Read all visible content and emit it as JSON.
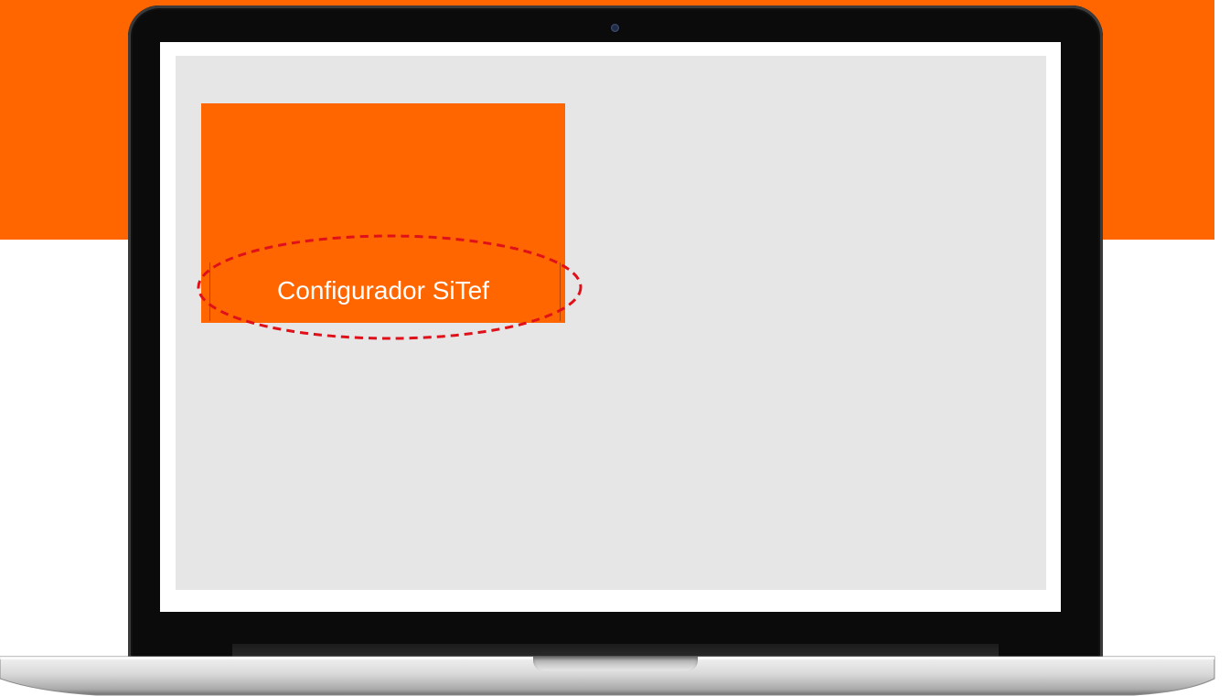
{
  "colors": {
    "brand_orange": "#ff6600",
    "screen_background": "#e6e6e6",
    "annotation_red": "#e0101a"
  },
  "app_tile": {
    "label": "Configurador SiTef"
  },
  "annotation": {
    "shape": "dashed-ellipse"
  }
}
